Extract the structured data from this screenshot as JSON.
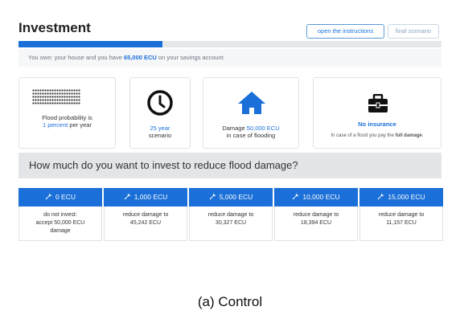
{
  "header": {
    "title": "Investment",
    "instructions_label": "open the instructions",
    "final_label": "final scenario"
  },
  "progress": {
    "fraction": 0.34
  },
  "savings": {
    "prefix": "You own: your house and you have ",
    "amount": "65,000 ECU",
    "suffix": " on your savings account"
  },
  "cards": {
    "probability": {
      "line1": "Flood probability is",
      "highlight": "1 percent",
      "rest": " per year"
    },
    "scenario": {
      "line1": "25 year",
      "line2": "scenario"
    },
    "damage": {
      "prefix": "Damage ",
      "amount": "50,000 ECU",
      "line2": "in case of flooding"
    },
    "insurance": {
      "title": "No insurance",
      "note_prefix": "In case of a flood you pay the ",
      "note_bold": "full damage",
      "note_suffix": "."
    }
  },
  "question": "How much do you want to invest to reduce flood damage?",
  "options": [
    {
      "label": "0 ECU",
      "line1": "do not invest:",
      "line2": "accept 50,000 ECU",
      "line3": "damage"
    },
    {
      "label": "1,000 ECU",
      "line1": "reduce damage to",
      "line2": "45,242 ECU",
      "line3": ""
    },
    {
      "label": "5,000 ECU",
      "line1": "reduce damage to",
      "line2": "30,327 ECU",
      "line3": ""
    },
    {
      "label": "10,000 ECU",
      "line1": "reduce damage to",
      "line2": "18,394 ECU",
      "line3": ""
    },
    {
      "label": "15,000 ECU",
      "line1": "reduce damage to",
      "line2": "11,157 ECU",
      "line3": ""
    }
  ],
  "caption": "(a) Control",
  "icons": {
    "probability": "dot-grid-icon",
    "scenario": "clock-icon",
    "damage": "house-icon",
    "insurance": "briefcase-icon",
    "option": "wrench-icon"
  },
  "colors": {
    "accent": "#1a6fd8",
    "panel": "#e3e5e8"
  }
}
